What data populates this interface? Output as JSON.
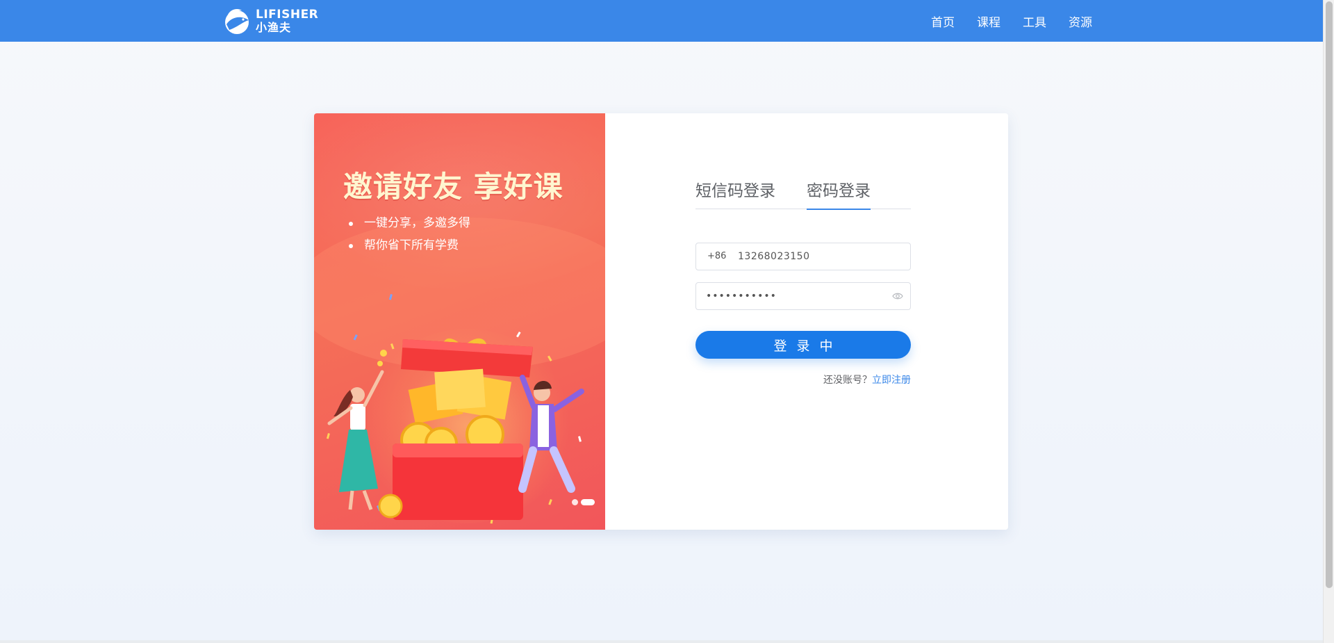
{
  "brand": {
    "name_en": "LIFISHER",
    "name_cn": "小渔夫"
  },
  "nav": {
    "items": [
      {
        "label": "首页"
      },
      {
        "label": "课程"
      },
      {
        "label": "工具"
      },
      {
        "label": "资源"
      }
    ]
  },
  "promo": {
    "title": "邀请好友  享好课",
    "bullets": [
      "一键分享，多邀多得",
      "帮你省下所有学费"
    ],
    "carousel": {
      "count": 2,
      "active_index": 1
    }
  },
  "login": {
    "tabs": [
      {
        "label": "短信码登录",
        "active": false
      },
      {
        "label": "密码登录",
        "active": true
      }
    ],
    "phone_prefix": "+86",
    "phone_value": "13268023150",
    "password_value": "•••••••••••",
    "submit_label": "登录中",
    "register_prompt": "还没账号？",
    "register_link": "立即注册"
  },
  "colors": {
    "header": "#3a87e8",
    "primary_button": "#1a7ae8",
    "promo_red": "#f56f58",
    "link": "#3a87e8"
  }
}
